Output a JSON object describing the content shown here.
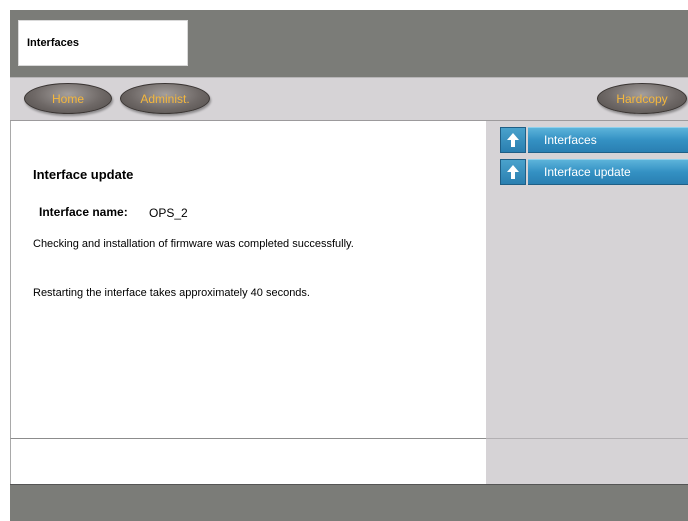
{
  "window": {
    "title": "Interfaces"
  },
  "nav": {
    "home_label": "Home",
    "admin_label": "Administ.",
    "hardcopy_label": "Hardcopy"
  },
  "main": {
    "heading": "Interface update",
    "interface_name_label": "Interface name:",
    "interface_name_value": "OPS_2",
    "message_firmware": "Checking and installation of firmware was completed successfully.",
    "message_restart": "Restarting the interface takes approximately 40 seconds."
  },
  "sidebar": {
    "items": [
      {
        "label": "Interfaces",
        "icon": "up-arrow-icon"
      },
      {
        "label": "Interface update",
        "icon": "up-arrow-icon"
      }
    ]
  },
  "colors": {
    "header_gray": "#7b7c78",
    "panel_gray": "#d6d3d6",
    "button_text_orange": "#f4b73d",
    "sidebar_button_blue": "#3491c3"
  }
}
